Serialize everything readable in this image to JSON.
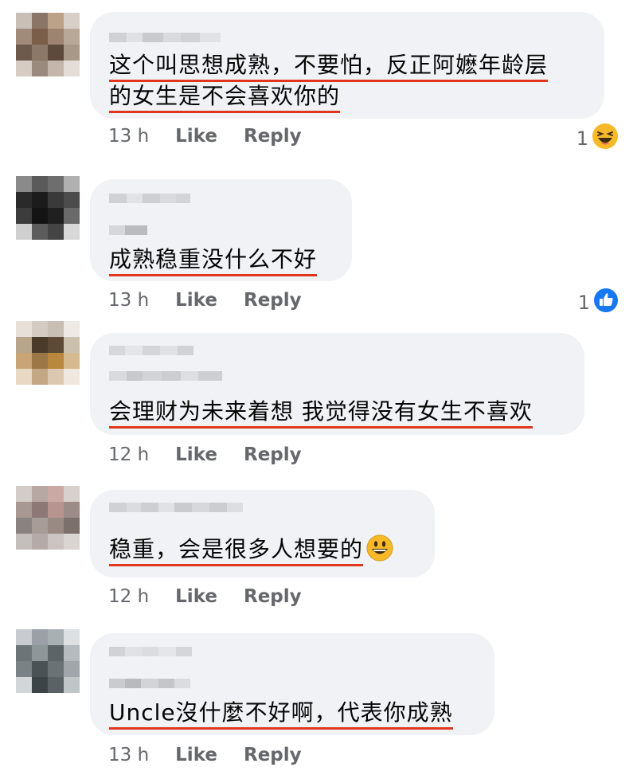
{
  "comments": [
    {
      "text_lines": [
        "这个叫思想成熟，不要怕，反正阿嬷年龄层",
        "的女生是不会喜欢你的"
      ],
      "time": "13 h",
      "like": "Like",
      "reply": "Reply",
      "reaction_count": "1",
      "reaction_icon": "laughing-emoji-icon"
    },
    {
      "text_lines": [
        "成熟稳重没什么不好"
      ],
      "time": "13 h",
      "like": "Like",
      "reply": "Reply",
      "reaction_count": "1",
      "reaction_icon": "thumbs-up-icon"
    },
    {
      "text_lines": [
        "会理财为未来着想 我觉得没有女生不喜欢"
      ],
      "time": "12 h",
      "like": "Like",
      "reply": "Reply"
    },
    {
      "text_lines": [
        "稳重，会是很多人想要的"
      ],
      "emoji": "smiling-emoji-icon",
      "time": "12 h",
      "like": "Like",
      "reply": "Reply"
    },
    {
      "text_lines": [
        "Uncle沒什麼不好啊，代表你成熟"
      ],
      "time": "13 h",
      "like": "Like",
      "reply": "Reply"
    }
  ],
  "colors": {
    "bubble": "#f0f2f5",
    "underline": "#e0361c",
    "meta_text": "#65676b",
    "like_blue": "#1877f2",
    "emoji_yellow": "#f7b928"
  }
}
